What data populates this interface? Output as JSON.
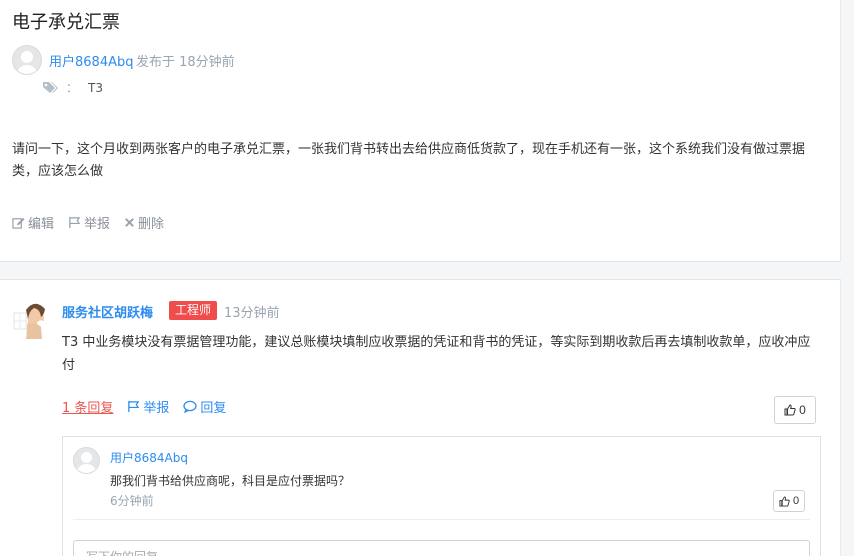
{
  "question": {
    "title": "电子承兑汇票",
    "author": "用户8684Abq",
    "posted": "发布于 18分钟前",
    "tag_colon": "：",
    "tag": "T3",
    "body": "请问一下，这个月收到两张客户的电子承兑汇票，一张我们背书转出去给供应商低货款了，现在手机还有一张，这个系统我们没有做过票据类，应该怎么做",
    "actions": {
      "edit": "编辑",
      "report": "举报",
      "delete": "删除"
    }
  },
  "answer": {
    "author": "服务社区胡跃梅",
    "badge": "工程师",
    "time": "13分钟前",
    "body": "T3 中业务模块没有票据管理功能，建议总账模块填制应收票据的凭证和背书的凭证，等实际到期收款后再去填制收款单，应收冲应付",
    "reply_count": "1 条回复",
    "report": "举报",
    "reply": "回复",
    "likes": "0"
  },
  "reply_item": {
    "author": "用户8684Abq",
    "text": "那我们背书给供应商呢，科目是应付票据吗？",
    "time": "6分钟前",
    "likes": "0"
  },
  "reply_input": {
    "placeholder": "写下你的回复..."
  },
  "colors": {
    "link": "#2d8cf0",
    "badge": "#f04c4c",
    "reply_count": "#e8584f"
  },
  "icons": [
    "tags-icon",
    "edit-icon",
    "flag-icon",
    "close-icon",
    "comment-icon",
    "thumbs-up-icon"
  ]
}
